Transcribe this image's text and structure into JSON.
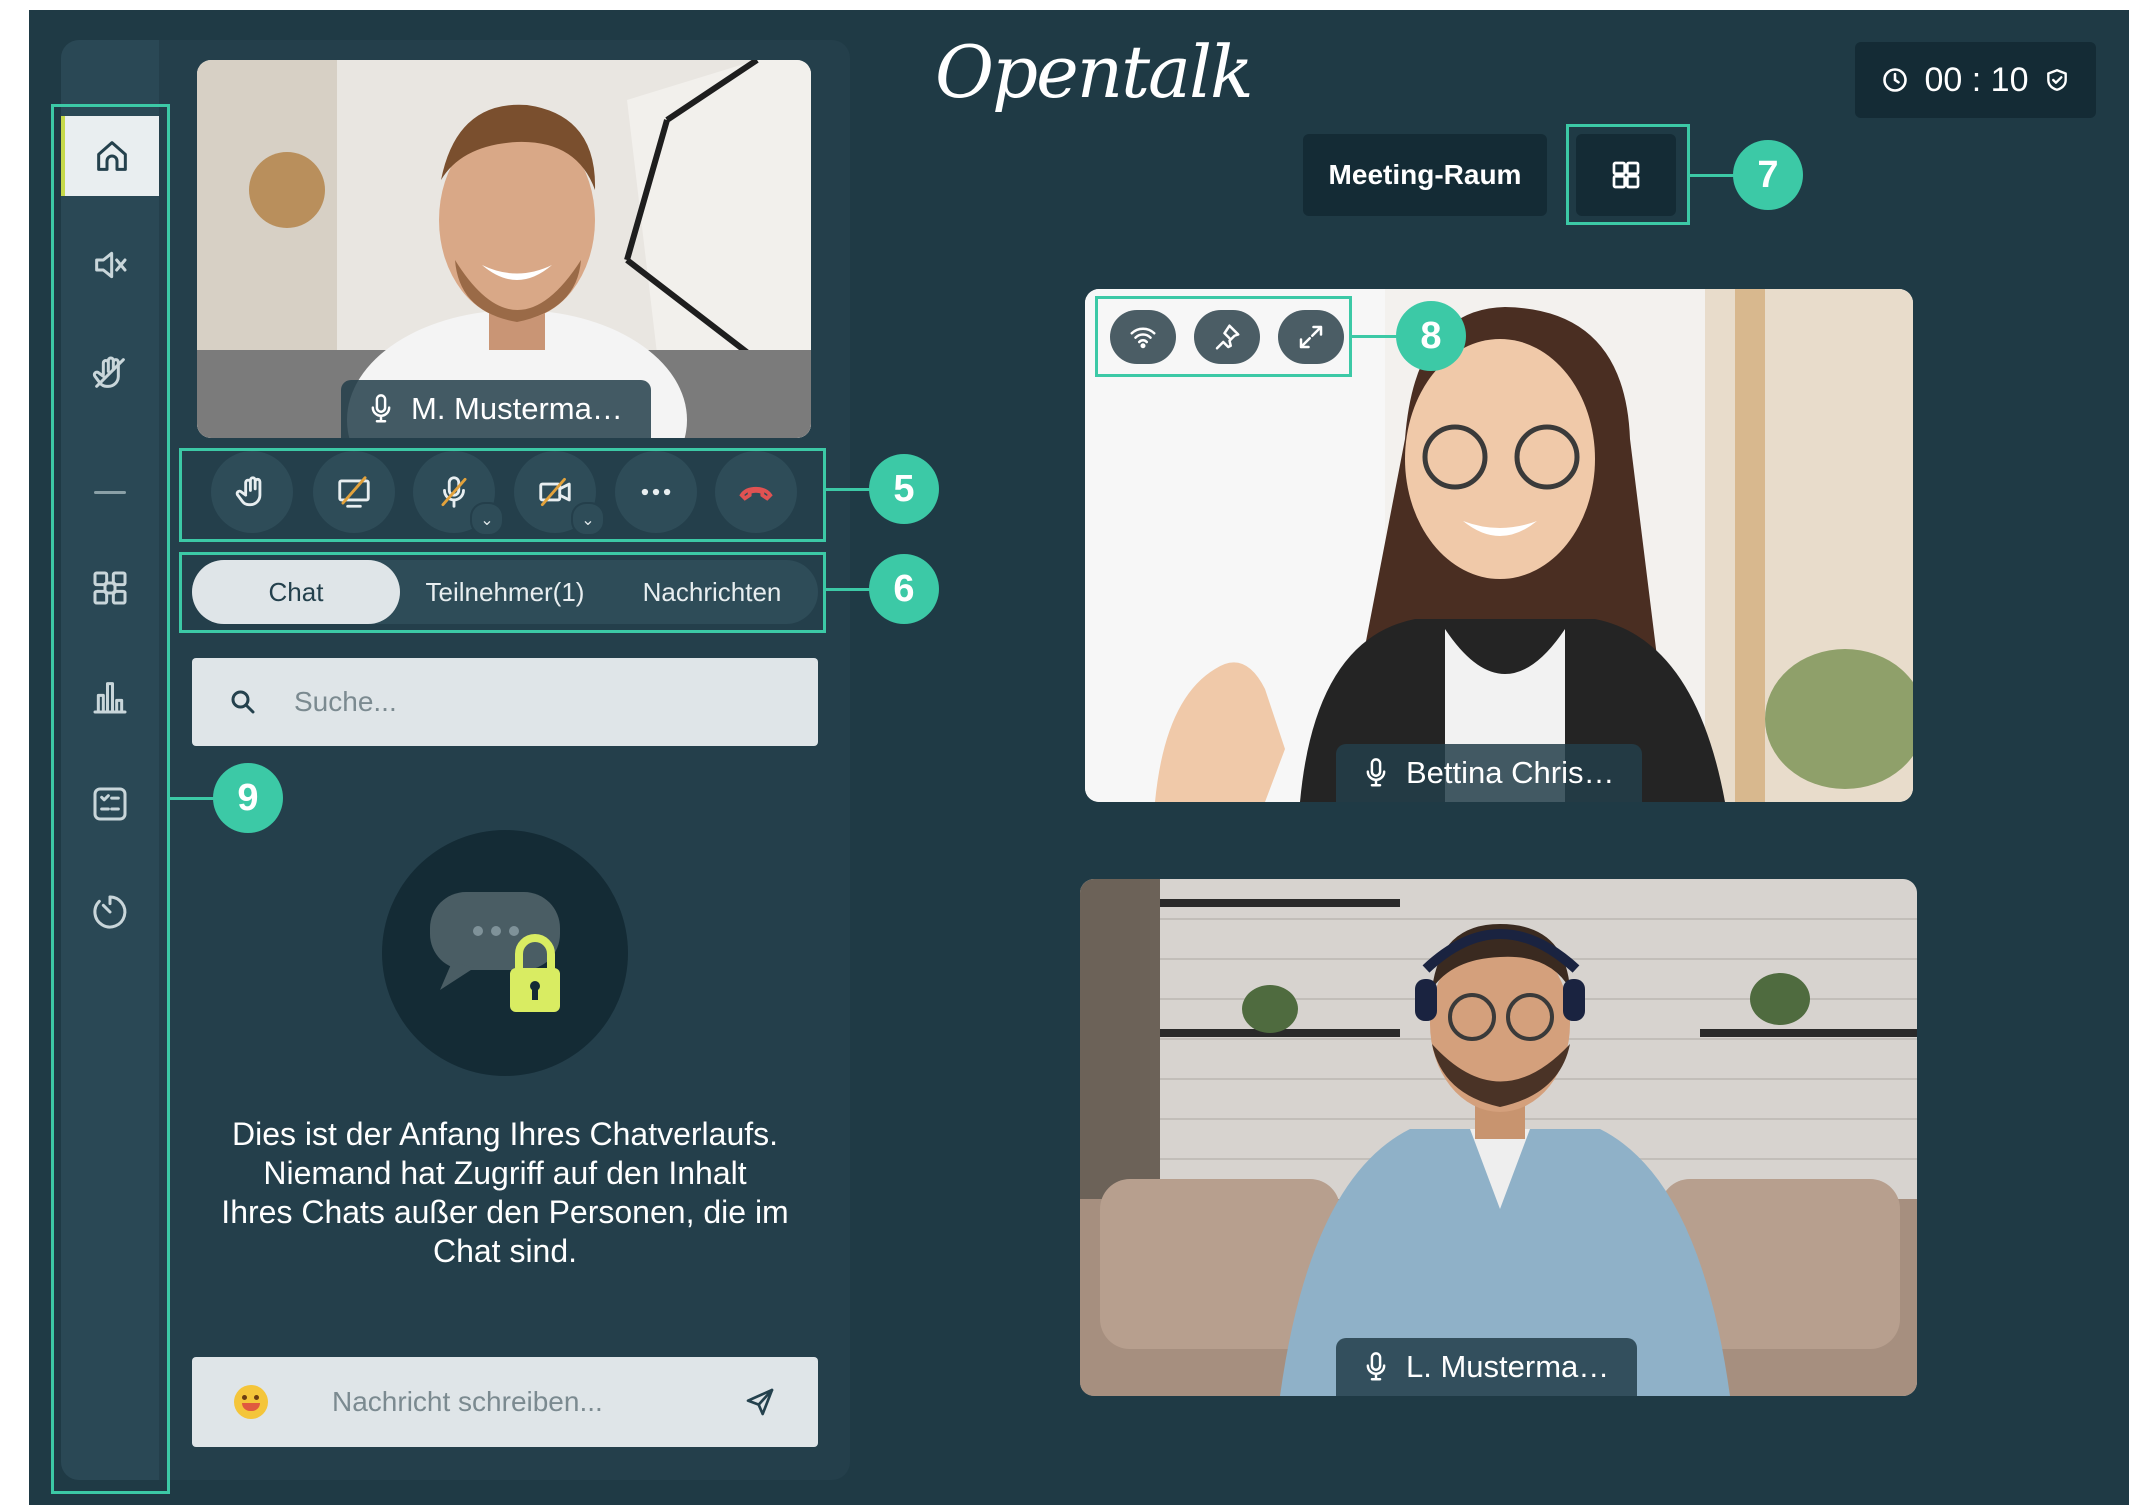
{
  "app": {
    "logo_text": "Opentalk",
    "timer": "00 : 10",
    "room_label": "Meeting-Raum"
  },
  "sidebar": {
    "items": [
      {
        "name": "home",
        "icon": "home-icon",
        "active": true
      },
      {
        "name": "mute-all",
        "icon": "speaker-muted-icon"
      },
      {
        "name": "lower-hands",
        "icon": "hand-off-icon"
      },
      {
        "name": "breakout-rooms",
        "icon": "rooms-grid-icon"
      },
      {
        "name": "poll",
        "icon": "bar-chart-icon"
      },
      {
        "name": "voting",
        "icon": "checklist-icon"
      },
      {
        "name": "timer",
        "icon": "timer-icon"
      }
    ]
  },
  "self_video": {
    "name": "M. Musterma…"
  },
  "controls": {
    "buttons": [
      {
        "name": "raise-hand",
        "icon": "hand-icon"
      },
      {
        "name": "screen-share",
        "icon": "screen-share-off-icon"
      },
      {
        "name": "microphone",
        "icon": "mic-off-icon",
        "has_menu": true
      },
      {
        "name": "camera",
        "icon": "camera-off-icon",
        "has_menu": true
      },
      {
        "name": "more",
        "icon": "more-icon"
      },
      {
        "name": "hang-up",
        "icon": "phone-hangup-icon"
      }
    ]
  },
  "tabs": [
    {
      "label": "Chat",
      "active": true
    },
    {
      "label": "Teilnehmer(1)"
    },
    {
      "label": "Nachrichten"
    }
  ],
  "search": {
    "placeholder": "Suche..."
  },
  "chat": {
    "empty_line1": "Dies ist der Anfang Ihres Chatverlaufs.",
    "empty_line2": "Niemand hat Zugriff auf den Inhalt",
    "empty_line3": "Ihres Chats außer den Personen, die im",
    "empty_line4": "Chat sind.",
    "input_placeholder": "Nachricht schreiben..."
  },
  "participants": [
    {
      "name": "Bettina Chris…"
    },
    {
      "name": "L. Musterma…"
    }
  ],
  "callouts": [
    "5",
    "6",
    "7",
    "8",
    "9"
  ],
  "colors": {
    "background": "#1f3a45",
    "panel": "#243f4b",
    "accent": "#3cc9a6",
    "active_marker": "#c6d94a",
    "hangup": "#e05252"
  }
}
